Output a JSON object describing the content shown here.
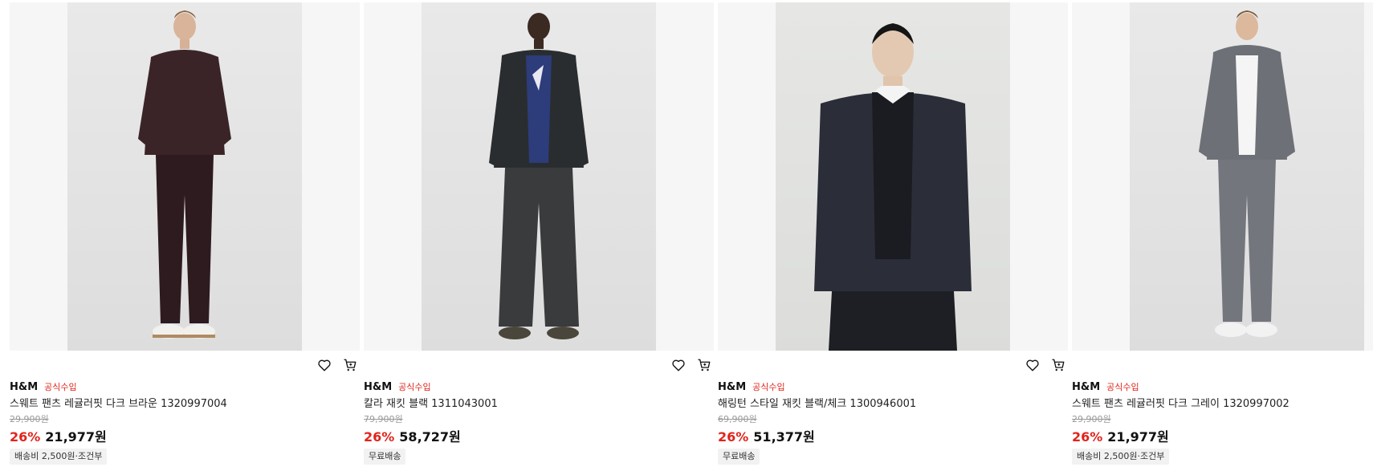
{
  "products": [
    {
      "brand": "H&M",
      "badge": "공식수입",
      "name": "스웨트 팬츠 레귤러핏 다크 브라운 1320997004",
      "original_price": "29,900원",
      "discount": "26%",
      "sale_price": "21,977원",
      "shipping": "배송비 2,500원·조건부",
      "image_desc": "model-brown-sweat-set",
      "colors": {
        "top": "#3b2428",
        "bottom": "#2e1b1f",
        "shoes": "#f2f0ec"
      }
    },
    {
      "brand": "H&M",
      "badge": "공식수입",
      "name": "칼라 재킷 블랙 1311043001",
      "original_price": "79,900원",
      "discount": "26%",
      "sale_price": "58,727원",
      "shipping": "무료배송",
      "image_desc": "model-black-leather-jacket",
      "colors": {
        "top": "#2a2d2f",
        "inner": "#2d3c7a",
        "bottom": "#3a3b3d",
        "shoes": "#4a463c"
      }
    },
    {
      "brand": "H&M",
      "badge": "공식수입",
      "name": "해링턴 스타일 재킷 블랙/체크 1300946001",
      "original_price": "69,900원",
      "discount": "26%",
      "sale_price": "51,377원",
      "shipping": "무료배송",
      "image_desc": "model-check-harrington-jacket",
      "colors": {
        "top": "#2b2e38",
        "inner": "#1a1c22",
        "bottom": "#1d1f24"
      }
    },
    {
      "brand": "H&M",
      "badge": "공식수입",
      "name": "스웨트 팬츠 레귤러핏 다크 그레이 1320997002",
      "original_price": "29,900원",
      "discount": "26%",
      "sale_price": "21,977원",
      "shipping": "배송비 2,500원·조건부",
      "image_desc": "model-grey-sweat-set",
      "colors": {
        "top": "#6e7078",
        "inner": "#f5f5f5",
        "bottom": "#74767e",
        "shoes": "#f2f2f2"
      }
    }
  ],
  "icons": {
    "wishlist": "heart-icon",
    "cart": "cart-icon"
  }
}
